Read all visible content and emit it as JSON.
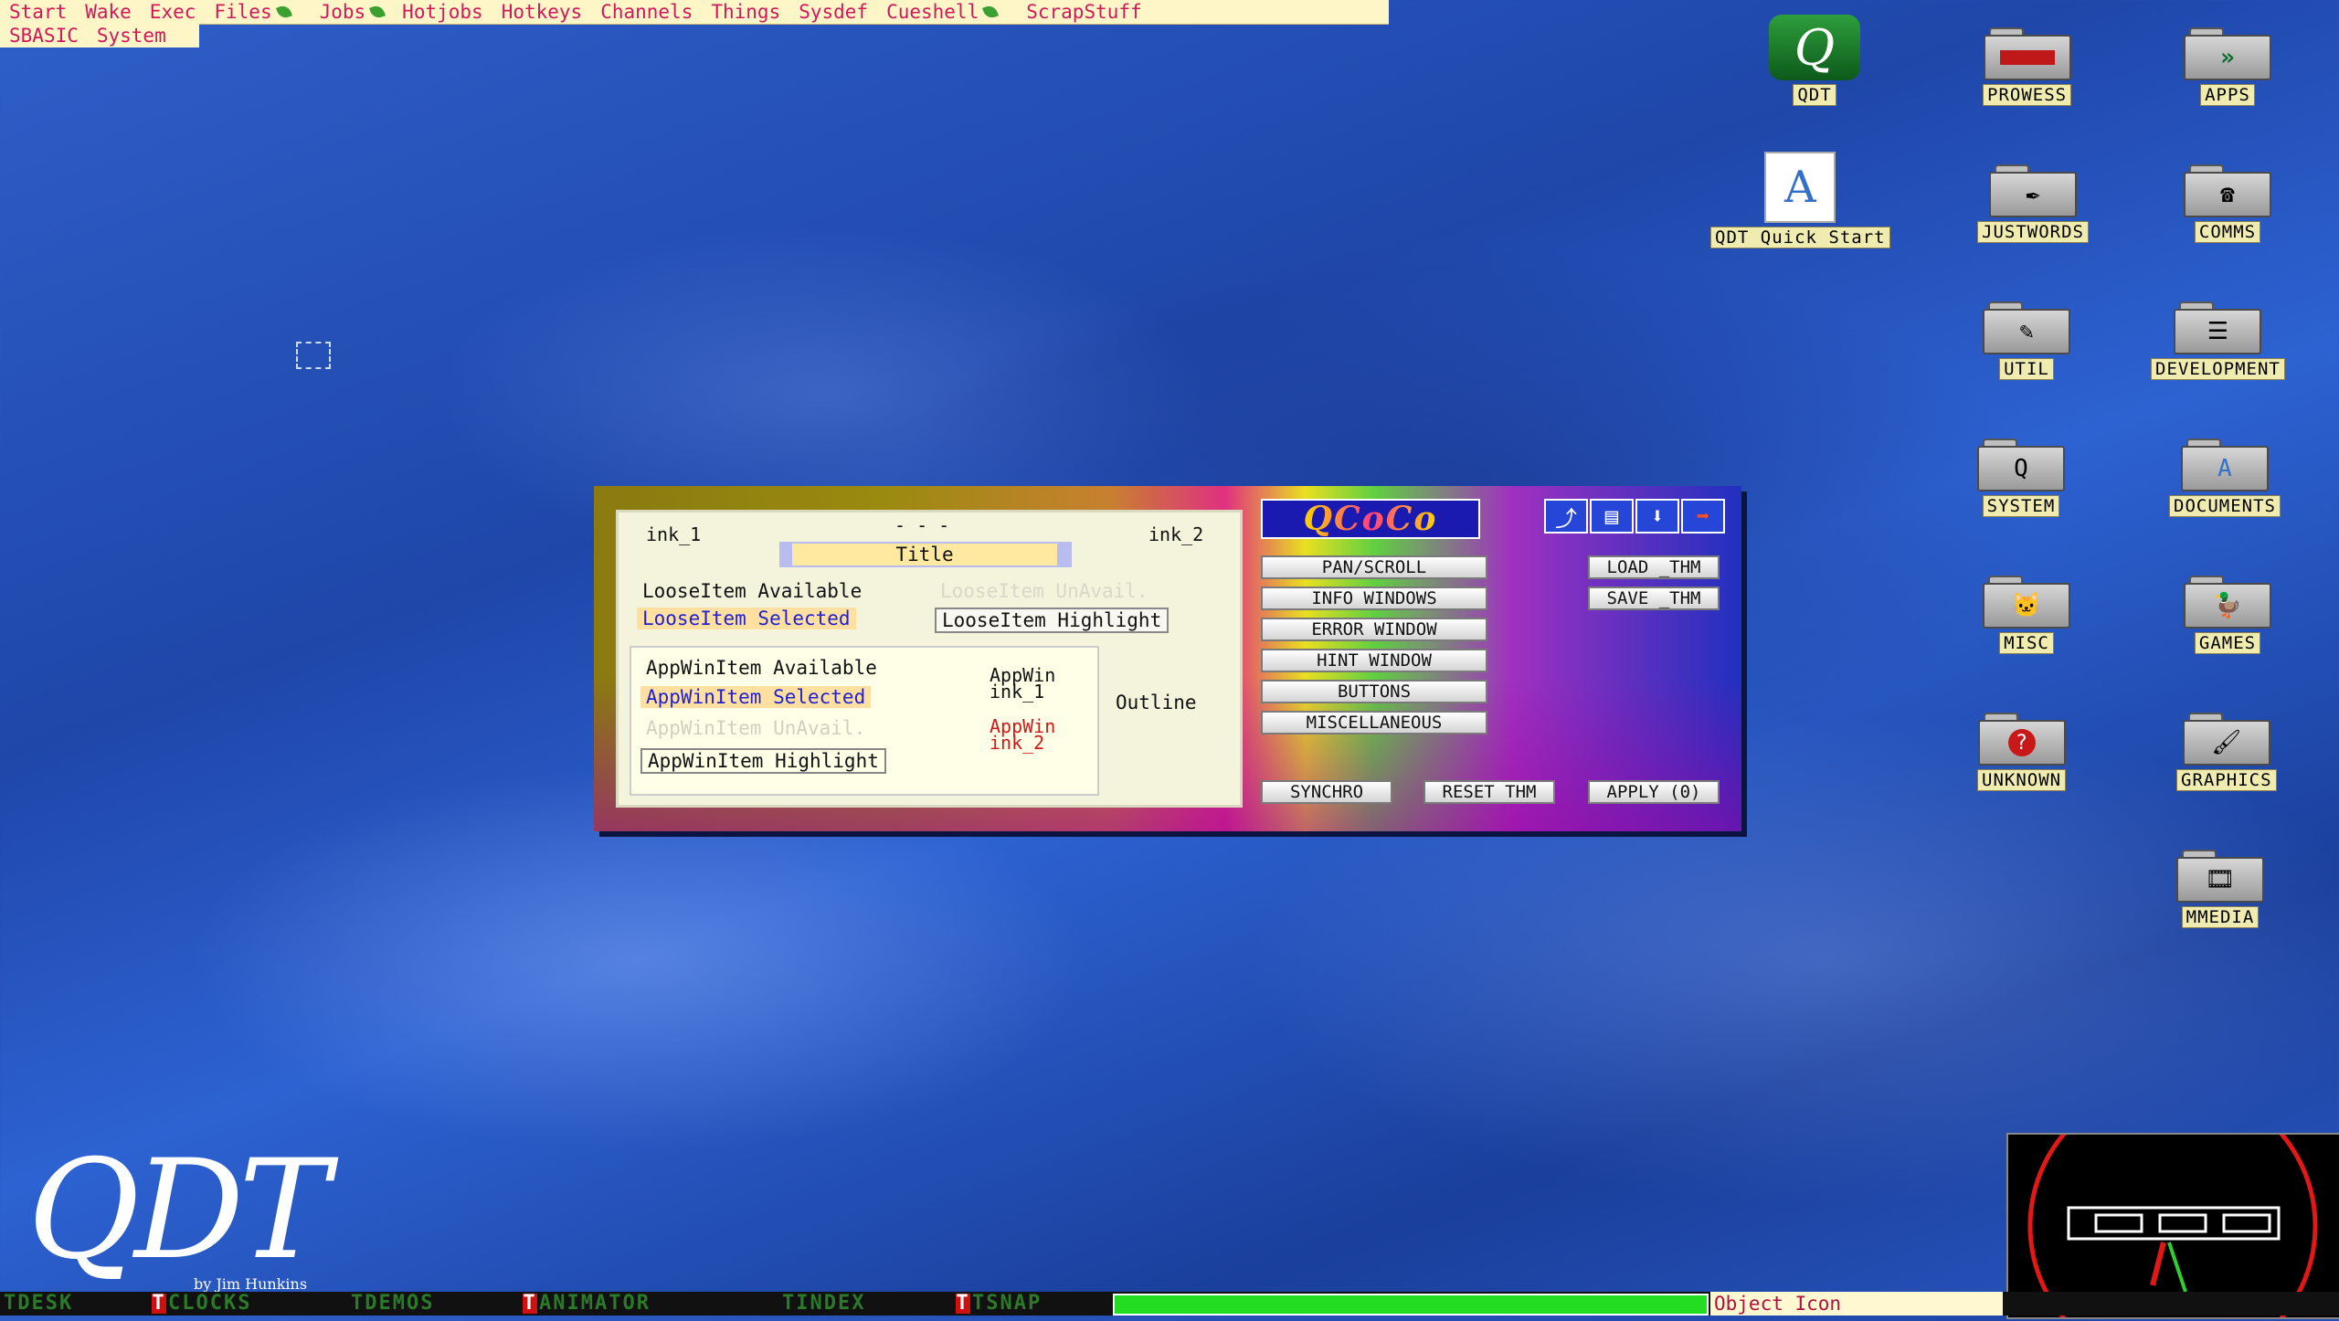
{
  "menubar": {
    "row1": [
      {
        "label": "Start"
      },
      {
        "label": "Wake"
      },
      {
        "label": "Exec"
      },
      {
        "label": "Files",
        "submenu": true
      },
      {
        "label": "Jobs",
        "submenu": true
      },
      {
        "label": "Hotjobs"
      },
      {
        "label": "Hotkeys"
      },
      {
        "label": "Channels"
      },
      {
        "label": "Things"
      },
      {
        "label": "Sysdef"
      },
      {
        "label": "Cueshell",
        "submenu": true
      },
      {
        "label": "ScrapStuff"
      }
    ],
    "row2": [
      {
        "label": "SBASIC"
      },
      {
        "label": "System"
      }
    ]
  },
  "desktop_icons": [
    {
      "label": "QDT",
      "icon": "qdt-app-icon"
    },
    {
      "label": "PROWESS",
      "icon": "folder-icon"
    },
    {
      "label": "APPS",
      "icon": "folder-icon"
    },
    {
      "label": "QDT Quick Start",
      "icon": "document-icon"
    },
    {
      "label": "JUSTWORDS",
      "icon": "folder-icon"
    },
    {
      "label": "COMMS",
      "icon": "folder-icon"
    },
    {
      "label": "UTIL",
      "icon": "folder-icon"
    },
    {
      "label": "DEVELOPMENT",
      "icon": "folder-icon"
    },
    {
      "label": "SYSTEM",
      "icon": "folder-icon"
    },
    {
      "label": "DOCUMENTS",
      "icon": "folder-icon"
    },
    {
      "label": "MISC",
      "icon": "folder-icon"
    },
    {
      "label": "GAMES",
      "icon": "folder-icon"
    },
    {
      "label": "UNKNOWN",
      "icon": "folder-icon"
    },
    {
      "label": "GRAPHICS",
      "icon": "folder-icon"
    },
    {
      "label": "MMEDIA",
      "icon": "folder-icon"
    }
  ],
  "qcoco": {
    "logo_text": "QCoCo",
    "preview": {
      "ink_1": "ink_1",
      "dashes": "- - -",
      "ink_2": "ink_2",
      "title": "Title",
      "loose_available": "LooseItem Available",
      "loose_unavail": "LooseItem UnAvail.",
      "loose_selected": "LooseItem Selected",
      "loose_highlight": "LooseItem Highlight",
      "appwin_available": "AppWinItem Available",
      "appwin_selected": "AppWinItem Selected",
      "appwin_unavail": "AppWinItem UnAvail.",
      "appwin_highlight": "AppWinItem Highlight",
      "appwin_ink1_a": "AppWin",
      "appwin_ink1_b": "ink_1",
      "appwin_ink2_a": "AppWin",
      "appwin_ink2_b": "ink_2",
      "outline": "Outline"
    },
    "buttons": {
      "pan_scroll": "PAN/SCROLL",
      "info_windows": "INFO WINDOWS",
      "error_window": "ERROR WINDOW",
      "hint_window": "HINT WINDOW",
      "buttons": "BUTTONS",
      "miscellaneous": "MISCELLANEOUS",
      "load_thm": "LOAD _THM",
      "save_thm": "SAVE _THM",
      "synchro": "SYNCHRO",
      "reset_thm": "RESET THM",
      "apply": "APPLY (0)"
    }
  },
  "taskbar": {
    "items": [
      "TDESK",
      "CLOCKS",
      "TDEMOS",
      "ANIMATOR",
      "TINDEX",
      "TSNAP"
    ],
    "progress_fraction": 1.0,
    "status_text": "Object Icon"
  },
  "branding": {
    "logo": "QDT",
    "byline": "by Jim Hunkins"
  },
  "colors": {
    "menu_bg": "#fff6c8",
    "menu_text": "#d0185a",
    "desktop_bg": "#2a56c0",
    "progress": "#22dd22"
  }
}
